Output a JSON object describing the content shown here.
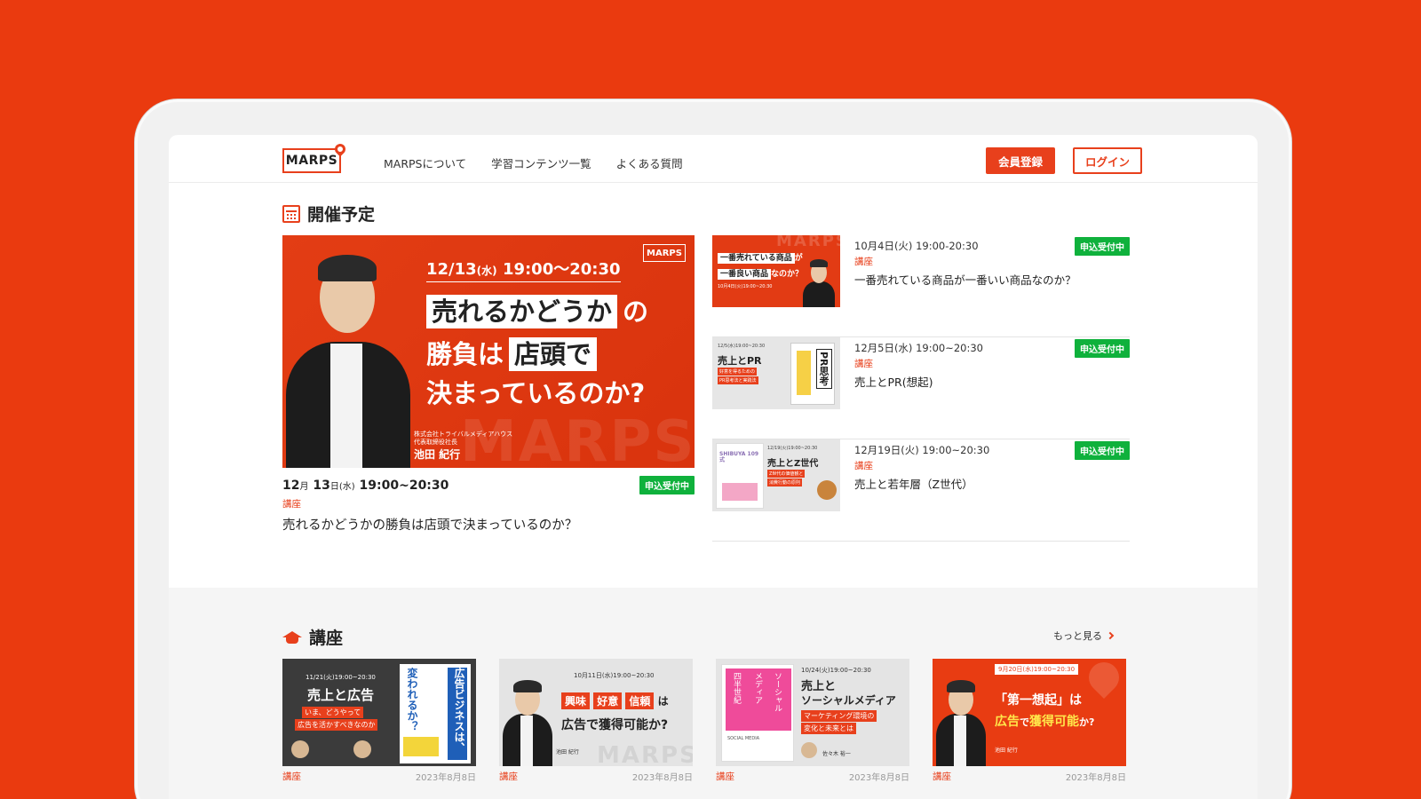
{
  "header": {
    "logo": "MARPS",
    "nav": [
      "MARPSについて",
      "学習コンテンツ一覧",
      "よくある質問"
    ],
    "register": "会員登録",
    "login": "ログイン"
  },
  "upcoming": {
    "title": "開催予定",
    "featured": {
      "banner_date": "12/13",
      "banner_dow": "(水)",
      "banner_time": "19:00〜20:30",
      "banner_line1a": "売れるかどうか",
      "banner_line1b": "の",
      "banner_line2a": "勝負は",
      "banner_line2b": "店頭で",
      "banner_line3": "決まっているのか?",
      "banner_company": "株式会社トライバルメディアハウス",
      "banner_role": "代表取締役社長",
      "banner_name": "池田 紀行",
      "date_m": "12",
      "date_m_unit": "月",
      "date_d": "13",
      "date_d_unit": "日(水)",
      "time": "19:00~20:30",
      "badge": "申込受付中",
      "category": "講座",
      "title": "売れるかどうかの勝負は店頭で決まっているのか？"
    },
    "list": [
      {
        "date": "10月4日(火) 19:00-20:30",
        "category": "講座",
        "title": "一番売れている商品が一番いい商品なのか？",
        "badge": "申込受付中",
        "thumb_line1": "一番売れている商品",
        "thumb_line1b": "が",
        "thumb_line2": "一番良い商品",
        "thumb_line2b": "なのか？",
        "thumb_date": "10月4日(火)19:00~20:30"
      },
      {
        "date": "12月5日(水) 19:00~20:30",
        "category": "講座",
        "title": "売上とPR(想起)",
        "badge": "申込受付中",
        "thumb_date": "12/5(水)19:00~20:30",
        "thumb_title": "売上とPR",
        "thumb_sub1": "好意を得るための",
        "thumb_sub2": "PR思考法と実践法",
        "thumb_book": "PR思考"
      },
      {
        "date": "12月19日(火) 19:00~20:30",
        "category": "講座",
        "title": "売上と若年層（Z世代）",
        "badge": "申込受付中",
        "thumb_date": "12/19(火)19:00~20:30",
        "thumb_title": "売上とZ世代",
        "thumb_sub1": "Z世代の価値観と",
        "thumb_sub2": "消費行動の原則",
        "thumb_book": "SHIBUYA 109式"
      }
    ]
  },
  "courses": {
    "title": "講座",
    "more": "もっと見る",
    "cards": [
      {
        "category": "講座",
        "date": "2023年8月8日",
        "thumb_date": "11/21(火)19:00~20:30",
        "thumb_title": "売上と広告",
        "thumb_sub1": "いま、どうやって",
        "thumb_sub2": "広告を活かすべきなのか",
        "thumb_book1": "変われるか？",
        "thumb_book2": "広告ビジネスは、"
      },
      {
        "category": "講座",
        "date": "2023年8月8日",
        "thumb_date": "10月11日(水)19:00~20:30",
        "thumb_w1": "興味",
        "thumb_w2": "好意",
        "thumb_w3": "信頼",
        "thumb_wa": "は",
        "thumb_line2": "広告で獲得可能か?",
        "thumb_name": "池田 紀行"
      },
      {
        "category": "講座",
        "date": "2023年8月8日",
        "thumb_date": "10/24(火)19:00~20:30",
        "thumb_title1": "売上と",
        "thumb_title2": "ソーシャルメディア",
        "thumb_sub1": "マーケティング環境の",
        "thumb_sub2": "変化と未来とは",
        "thumb_book1": "ソーシャル",
        "thumb_book2": "メディア",
        "thumb_book3": "四半世紀",
        "thumb_book_en": "SOCIAL MEDIA",
        "thumb_name": "佐々木 裕一"
      },
      {
        "category": "講座",
        "date": "2023年8月8日",
        "thumb_date": "9月20日(水)19:00~20:30",
        "thumb_line1": "「第一想起」は",
        "thumb_line2a": "広告",
        "thumb_line2b": "で",
        "thumb_line2c": "獲得可能",
        "thumb_line2d": "か?",
        "thumb_name": "池田 紀行"
      }
    ]
  },
  "colors": {
    "brand": "#e8401c",
    "badge": "#0fb13c",
    "background": "#ea3a0f"
  }
}
